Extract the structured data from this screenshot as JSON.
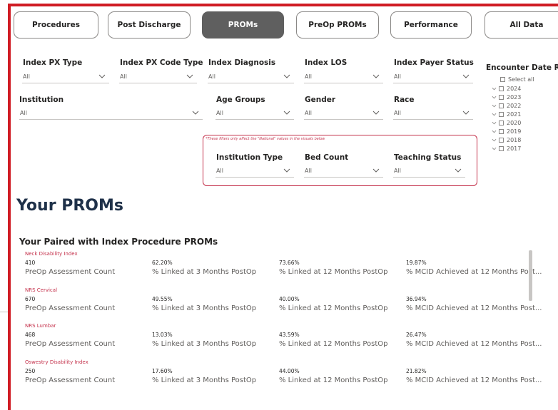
{
  "tabs": [
    {
      "label": "Procedures",
      "active": false
    },
    {
      "label": "Post Discharge",
      "active": false
    },
    {
      "label": "PROMs",
      "active": true
    },
    {
      "label": "PreOp PROMs",
      "active": false
    },
    {
      "label": "Performance",
      "active": false
    },
    {
      "label": "All Data",
      "active": false
    }
  ],
  "filters": {
    "index_px_type": {
      "label": "Index PX Type",
      "value": "All"
    },
    "index_px_code_type": {
      "label": "Index PX Code Type",
      "value": "All"
    },
    "index_diagnosis": {
      "label": "Index Diagnosis",
      "value": "All"
    },
    "index_los": {
      "label": "Index LOS",
      "value": "All"
    },
    "index_payer_status": {
      "label": "Index Payer Status",
      "value": "All"
    },
    "institution": {
      "label": "Institution",
      "value": "All"
    },
    "age_groups": {
      "label": "Age Groups",
      "value": "All"
    },
    "gender": {
      "label": "Gender",
      "value": "All"
    },
    "race": {
      "label": "Race",
      "value": "All"
    },
    "national_note": "*These filters only affect the \"National\" values in the visuals below",
    "institution_type": {
      "label": "Institution Type",
      "value": "All"
    },
    "bed_count": {
      "label": "Bed Count",
      "value": "All"
    },
    "teaching_status": {
      "label": "Teaching Status",
      "value": "All"
    }
  },
  "encounter_date_range": {
    "title": "Encounter Date Rang",
    "select_all": "Select all",
    "years": [
      "2024",
      "2023",
      "2022",
      "2021",
      "2020",
      "2019",
      "2018",
      "2017"
    ]
  },
  "page_title": "Your PROMs",
  "section_title": "Your Paired with Index Procedure PROMs",
  "proms": [
    {
      "name": "Neck Disability Index",
      "count": "410",
      "linked3": "62.20%",
      "linked12": "73.66%",
      "mcid": "19.87%"
    },
    {
      "name": "NRS Cervical",
      "count": "670",
      "linked3": "49.55%",
      "linked12": "40.00%",
      "mcid": "36.94%"
    },
    {
      "name": "NRS Lumbar",
      "count": "468",
      "linked3": "13.03%",
      "linked12": "43.59%",
      "mcid": "26.47%"
    },
    {
      "name": "Oswestry Disability Index",
      "count": "250",
      "linked3": "17.60%",
      "linked12": "44.00%",
      "mcid": "21.82%"
    }
  ],
  "metric_labels": {
    "count": "PreOp Assessment Count",
    "linked3": "% Linked at 3 Months PostOp",
    "linked12": "% Linked at 12 Months PostOp",
    "mcid": "% MCID Achieved at 12 Months Post..."
  },
  "icons": {
    "dropdown": "chevron-down-icon",
    "tree": "chevron-down-icon",
    "checkbox": "checkbox-icon"
  },
  "colors": {
    "accent": "#d01c24",
    "active_tab": "#5f5f5f",
    "highlight": "#c4314b",
    "title": "#1f3149"
  }
}
